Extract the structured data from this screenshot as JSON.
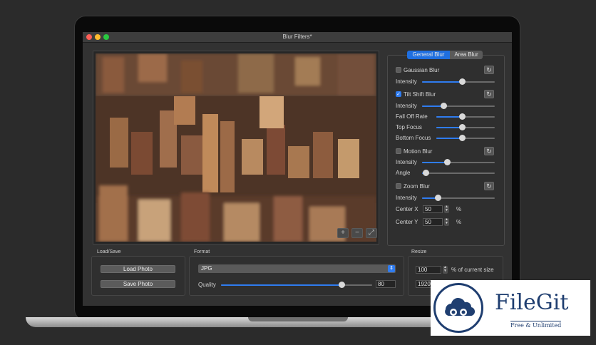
{
  "window": {
    "title": "Blur Filters*"
  },
  "tabs": [
    {
      "label": "General Blur",
      "active": true
    },
    {
      "label": "Area Blur",
      "active": false
    }
  ],
  "filters": {
    "gaussian": {
      "label": "Gaussian Blur",
      "enabled": false,
      "sliders": [
        {
          "label": "Intensity",
          "value": 0.55
        }
      ]
    },
    "tilt_shift": {
      "label": "Tilt Shift Blur",
      "enabled": true,
      "sliders": [
        {
          "label": "Intensity",
          "value": 0.3
        },
        {
          "label": "Fall Off Rate",
          "value": 0.45
        },
        {
          "label": "Top Focus",
          "value": 0.45
        },
        {
          "label": "Bottom Focus",
          "value": 0.45
        }
      ]
    },
    "motion": {
      "label": "Motion Blur",
      "enabled": false,
      "sliders": [
        {
          "label": "Intensity",
          "value": 0.35
        },
        {
          "label": "Angle",
          "value": 0.05
        }
      ]
    },
    "zoom": {
      "label": "Zoom Blur",
      "enabled": false,
      "sliders": [
        {
          "label": "Intensity",
          "value": 0.22
        }
      ],
      "center_x": {
        "label": "Center X",
        "value": "50",
        "unit": "%"
      },
      "center_y": {
        "label": "Center Y",
        "value": "50",
        "unit": "%"
      }
    }
  },
  "photo_controls": {
    "zoom_in": "+",
    "zoom_out": "−",
    "fit": "⤢"
  },
  "load_save": {
    "title": "Load/Save",
    "load": "Load Photo",
    "save": "Save Photo"
  },
  "format": {
    "title": "Format",
    "selected": "JPG",
    "quality_label": "Quality",
    "quality_value": "80",
    "quality_level": 0.8
  },
  "resize": {
    "title": "Resize",
    "percent_value": "100",
    "percent_label": "% of current size",
    "width_value": "1920"
  },
  "watermark": {
    "name": "FileGit",
    "tagline": "Free & Unlimited"
  },
  "colors": {
    "accent": "#2f7cf0",
    "window_bg": "#323232",
    "brand": "#1f3e70"
  }
}
